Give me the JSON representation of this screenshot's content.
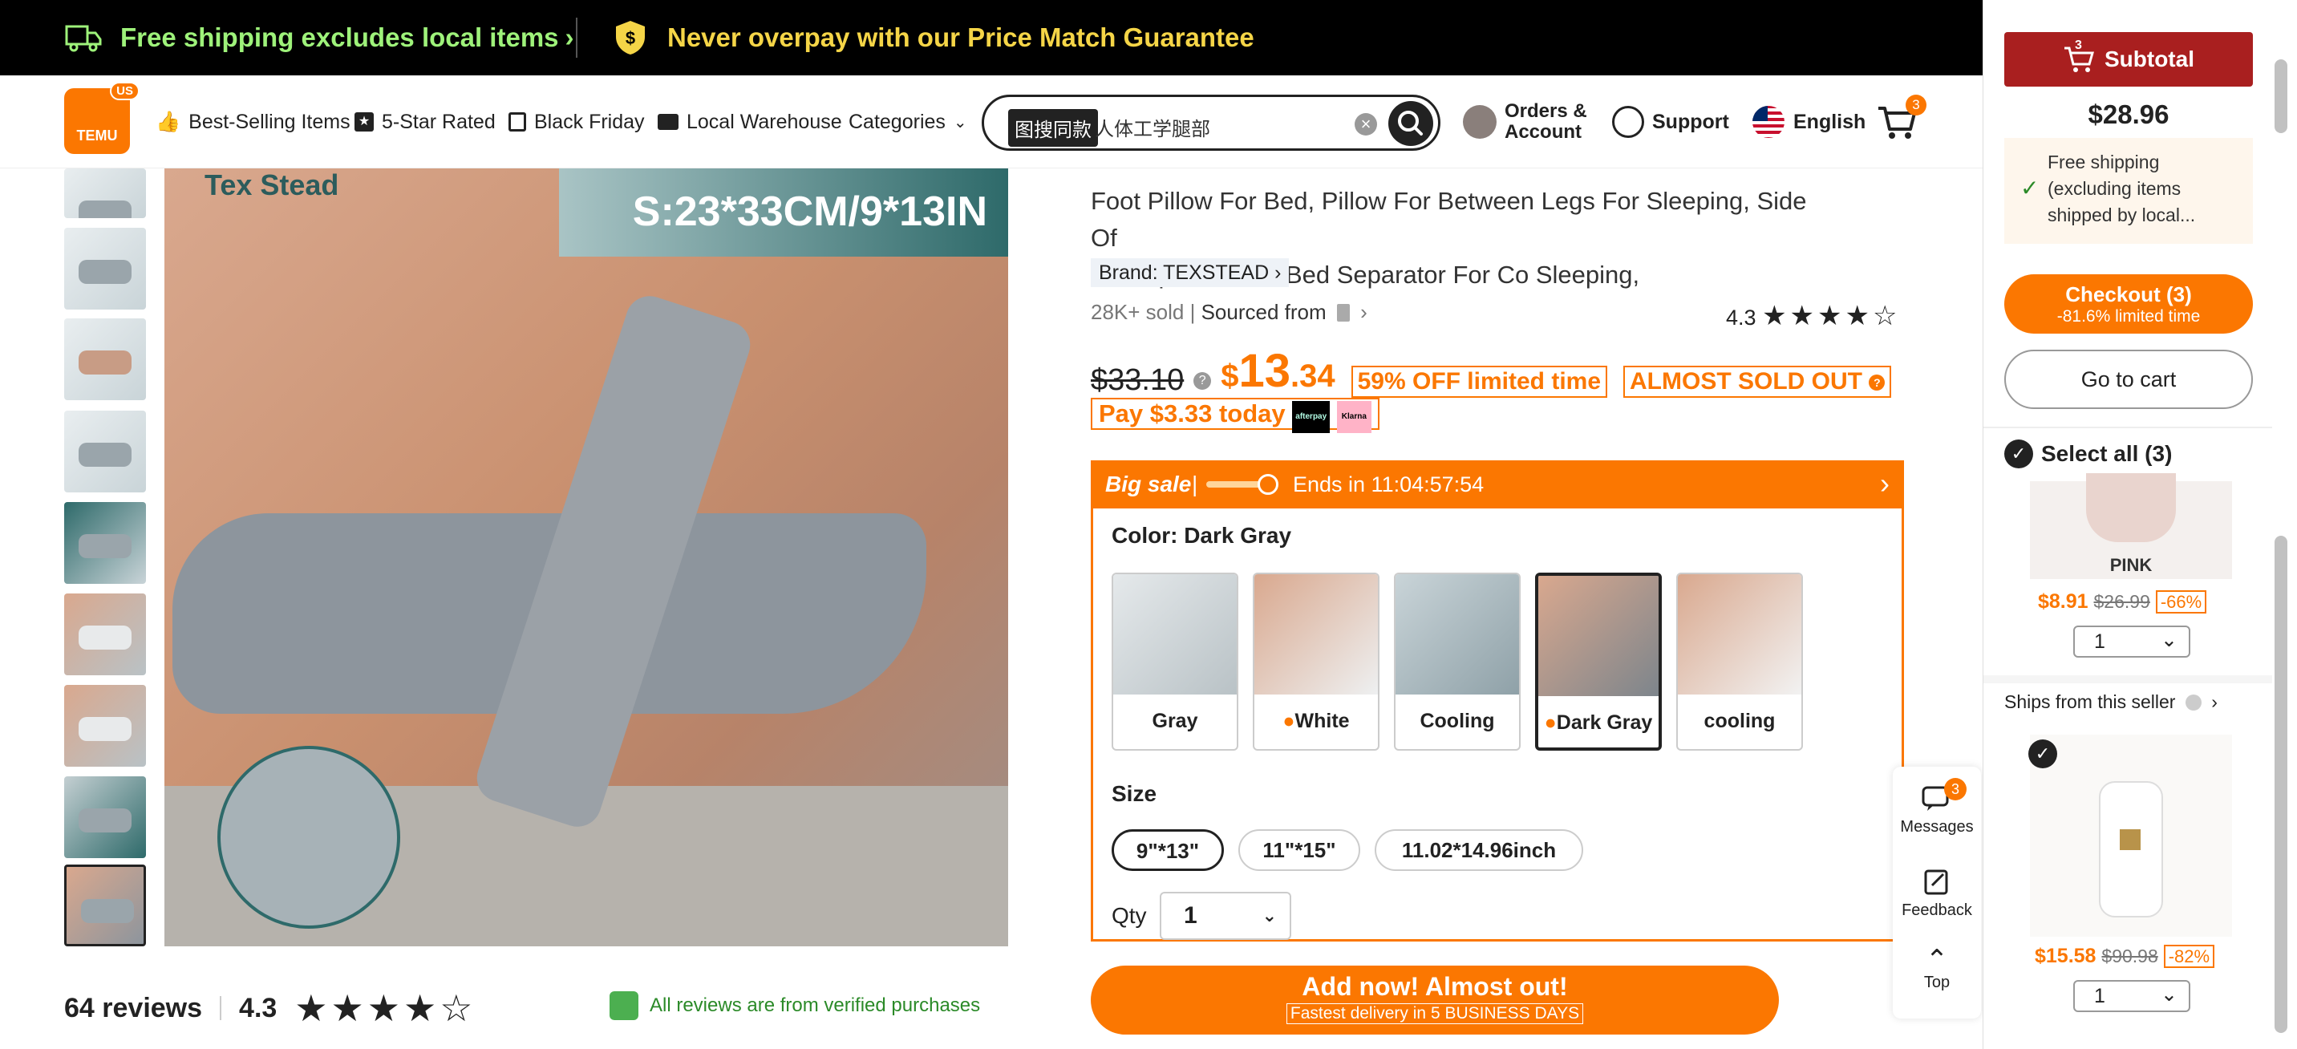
{
  "topbar": {
    "shipping_text": "Free shipping excludes local items",
    "price_match_text": "Never overpay with our Price Match Guarantee"
  },
  "header": {
    "logo_text": "TEMU",
    "logo_badge": "US",
    "nav": [
      "Best-Selling Items",
      "5-Star Rated",
      "Black Friday",
      "Local Warehouse",
      "Categories"
    ],
    "search": {
      "image_search_chip": "图搜同款",
      "value": "人体工学腿部",
      "clear": "×"
    },
    "orders_line1": "Orders &",
    "orders_line2": "Account",
    "support": "Support",
    "language": "English",
    "cart_count": "3"
  },
  "gallery": {
    "image_size_text": "S:23*33CM/9*13IN",
    "image_brand_text": "Tex Stead",
    "thumb_count": 9
  },
  "reviews": {
    "count_text": "64 reviews",
    "rating": "4.3",
    "stars": "★★★★☆",
    "verified_text": "All reviews are from verified purchases"
  },
  "product": {
    "title_line1": "Foot Pillow For Bed, Pillow For Between Legs For Sleeping, Side Of",
    "title_line2": "Bed Space Filler, Bed Separator For Co Sleeping,",
    "brand": "Brand: TEXSTEAD",
    "sold_text": "28K+ sold",
    "sourced_text": "Sourced from",
    "rating": "4.3",
    "stars": "★★★★☆",
    "old_price": "$33.10",
    "price_symbol": "$",
    "price_int": "13",
    "price_dec": ".34",
    "discount_tag": "59% OFF limited time",
    "almost_sold": "ALMOST SOLD OUT",
    "pay_today": "Pay $3.33 today",
    "pay_providers": [
      "afterpay",
      "Klarna"
    ],
    "sale_label": "Big sale",
    "sale_ends": "Ends in 11:04:57:54",
    "color_label": "Color: Dark Gray",
    "colors": [
      "Gray",
      "White",
      "Cooling",
      "Dark Gray",
      "cooling white"
    ],
    "size_label": "Size",
    "sizes": [
      "9\"*13\"",
      "11\"*15\"",
      "11.02*14.96inch"
    ],
    "qty_label": "Qty",
    "qty_value": "1",
    "add_button": "Add now! Almost out!",
    "add_sub": "Fastest delivery in 5 BUSINESS DAYS"
  },
  "tools": {
    "messages": "Messages",
    "messages_badge": "3",
    "feedback": "Feedback",
    "top": "Top"
  },
  "sidebar": {
    "subtotal_label": "Subtotal",
    "cart_badge": "3",
    "subtotal": "$28.96",
    "freeship_line1": "Free shipping",
    "freeship_line2": "(excluding items",
    "freeship_line3": "shipped by local...",
    "checkout_label": "Checkout (3)",
    "checkout_sub": "-81.6% limited time",
    "go_to_cart": "Go to cart",
    "select_all": "Select all (3)",
    "item1": {
      "label": "PINK",
      "price": "$8.91",
      "old": "$26.99",
      "disc": "-66%",
      "qty": "1"
    },
    "ships_from": "Ships from this seller",
    "item2": {
      "price": "$15.58",
      "old": "$90.98",
      "disc": "-82%",
      "qty": "1"
    }
  },
  "colors": {
    "accent": "#fb7701",
    "banner_green": "#9ef27a",
    "subtotal_red": "#a91f1f",
    "verified_green": "#2b8a28"
  }
}
